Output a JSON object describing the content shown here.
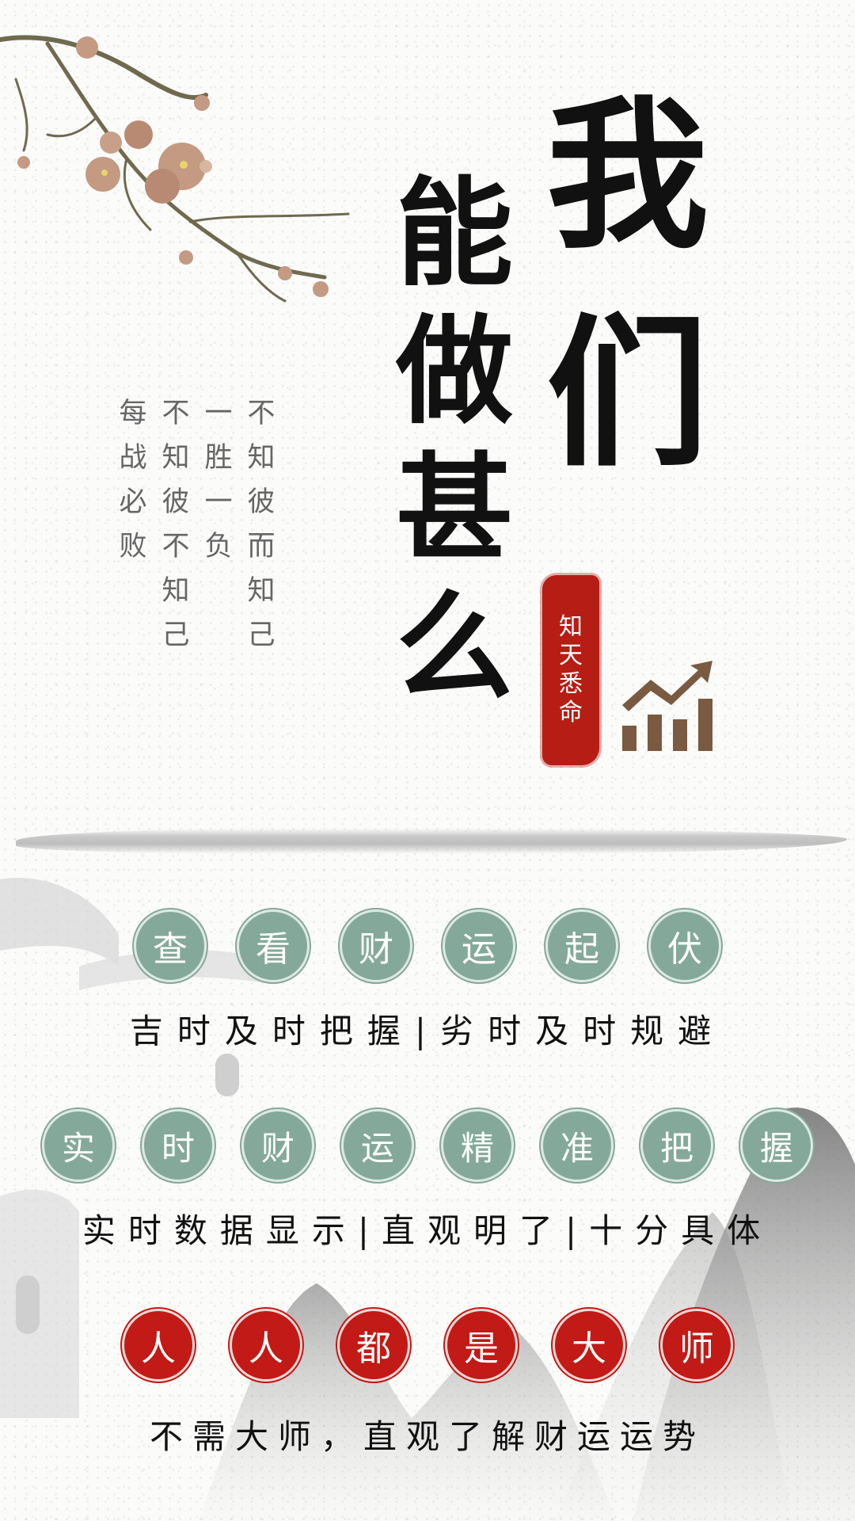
{
  "title": {
    "line1_chars": [
      "我",
      "们"
    ],
    "line2_chars": [
      "能",
      "做",
      "甚",
      "么"
    ]
  },
  "seal": {
    "chars": [
      "知",
      "天",
      "悉",
      "命"
    ],
    "color": "#b61d14"
  },
  "poem": {
    "columns": [
      [
        "不",
        "知",
        "彼",
        "而",
        "知",
        "己"
      ],
      [
        "一",
        "胜",
        "一",
        "负"
      ],
      [
        "不",
        "知",
        "彼",
        "不",
        "知",
        "己"
      ],
      [
        "每",
        "战",
        "必",
        "败"
      ]
    ]
  },
  "row1": {
    "chars": [
      "查",
      "看",
      "财",
      "运",
      "起",
      "伏"
    ],
    "caption": "吉时及时把握|劣时及时规避"
  },
  "row2": {
    "chars": [
      "实",
      "时",
      "财",
      "运",
      "精",
      "准",
      "把",
      "握"
    ],
    "caption": "实时数据显示|直观明了|十分具体"
  },
  "row3": {
    "chars": [
      "人",
      "人",
      "都",
      "是",
      "大",
      "师"
    ],
    "caption": "不需大师，直观了解财运运势"
  },
  "colors": {
    "green_circle": "#84a99a",
    "red_circle": "#c21a16",
    "growth_icon": "#7a5a40"
  },
  "icons": {
    "branch": "plum-blossom-branch",
    "growth": "growth-chart-icon",
    "mountains": "ink-mountains"
  }
}
